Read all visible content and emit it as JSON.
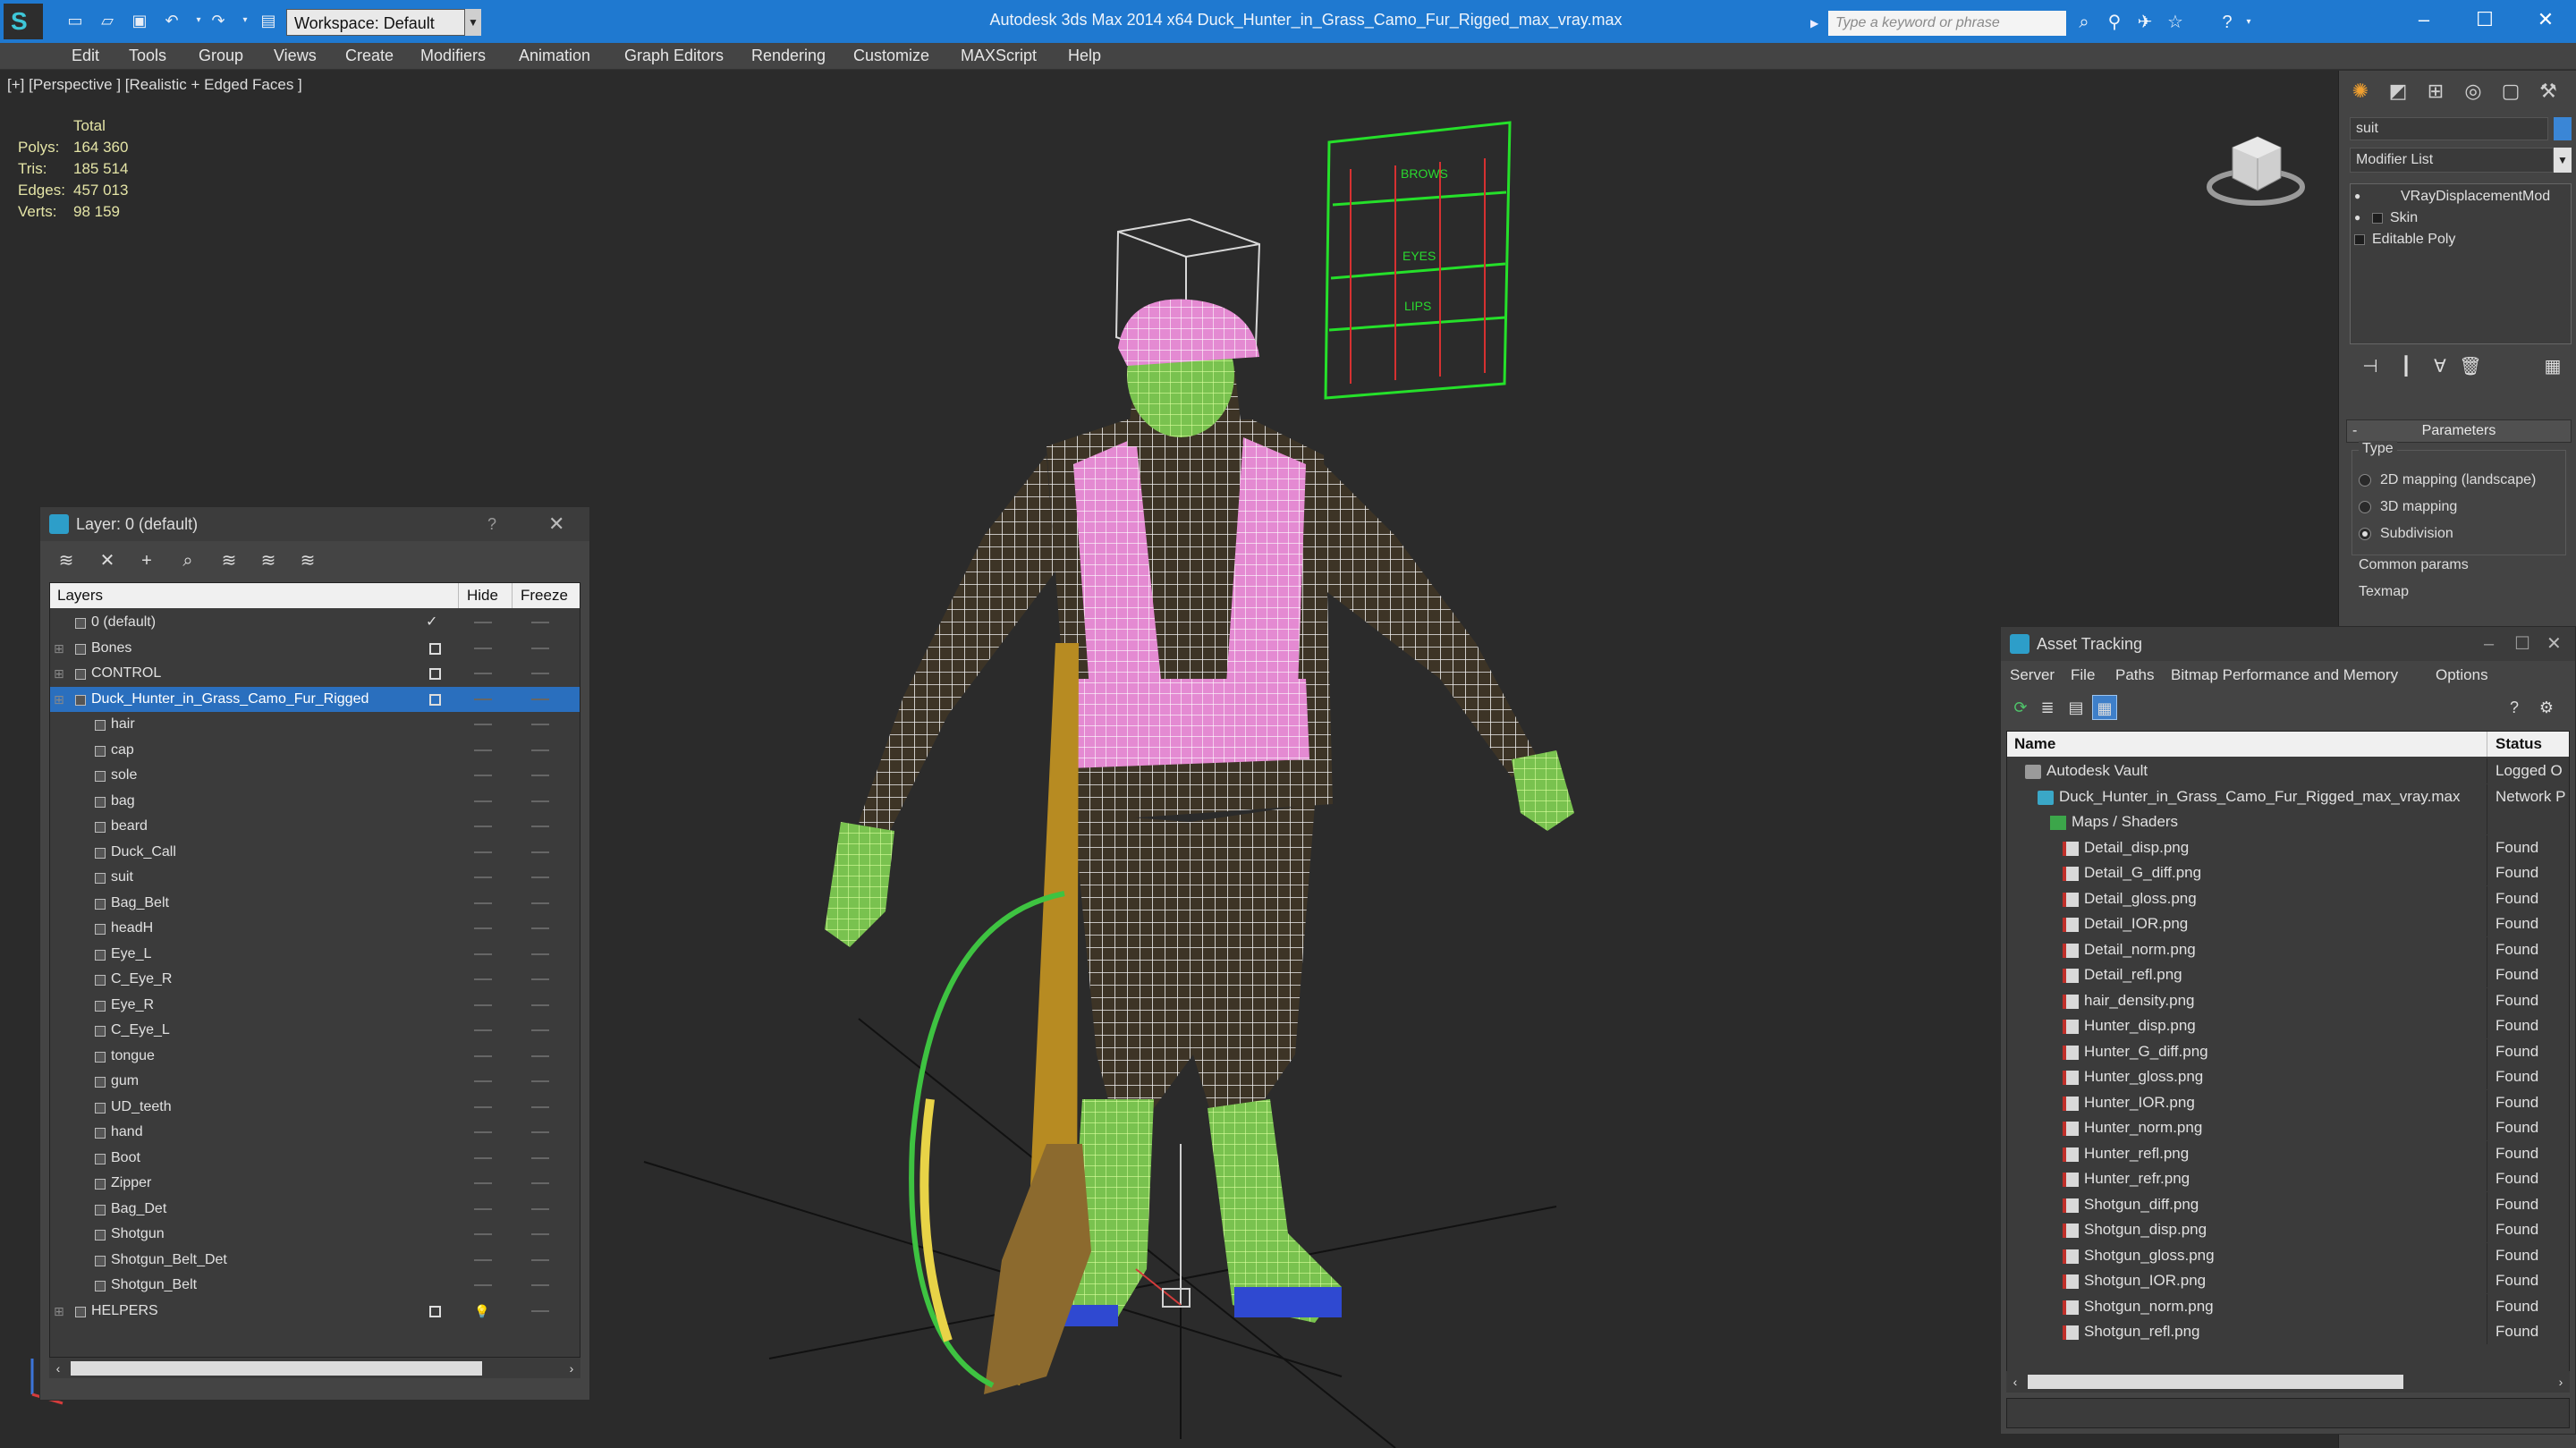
{
  "titlebar": {
    "workspace": "Workspace: Default",
    "title": "Autodesk 3ds Max  2014 x64      Duck_Hunter_in_Grass_Camo_Fur_Rigged_max_vray.max",
    "search_placeholder": "Type a keyword or phrase"
  },
  "menu": [
    "Edit",
    "Tools",
    "Group",
    "Views",
    "Create",
    "Modifiers",
    "Animation",
    "Graph Editors",
    "Rendering",
    "Customize",
    "MAXScript",
    "Help"
  ],
  "viewport": {
    "label": "[+] [Perspective ] [Realistic + Edged Faces ]",
    "stats_header": "Total",
    "stats": [
      {
        "key": "Polys:",
        "value": "164 360"
      },
      {
        "key": "Tris:",
        "value": "185 514"
      },
      {
        "key": "Edges:",
        "value": "457 013"
      },
      {
        "key": "Verts:",
        "value": "98 159"
      }
    ],
    "control_board_labels": [
      "BROWS",
      "EYES",
      "LIPS"
    ]
  },
  "command_panel": {
    "object_name": "suit",
    "object_color": "#3a86d6",
    "modifier_list": "Modifier List",
    "stack": [
      "VRayDisplacementMod",
      "Skin",
      "Editable Poly"
    ],
    "params_title": "Parameters",
    "type_label": "Type",
    "type_options": [
      {
        "label": "2D mapping (landscape)",
        "selected": false
      },
      {
        "label": "3D mapping",
        "selected": false
      },
      {
        "label": "Subdivision",
        "selected": true
      }
    ],
    "common_params": "Common params",
    "texmap": "Texmap"
  },
  "layer_panel": {
    "title": "Layer: 0 (default)",
    "help": "?",
    "col_layers": "Layers",
    "col_hide": "Hide",
    "col_freeze": "Freeze",
    "rows": [
      {
        "name": "0 (default)",
        "kind": "layer",
        "current": true
      },
      {
        "name": "Bones",
        "kind": "layer",
        "expand": true
      },
      {
        "name": "CONTROL",
        "kind": "layer",
        "expand": true
      },
      {
        "name": "Duck_Hunter_in_Grass_Camo_Fur_Rigged",
        "kind": "layer",
        "expand": true,
        "selected": true
      },
      {
        "name": "hair",
        "kind": "object"
      },
      {
        "name": "cap",
        "kind": "object"
      },
      {
        "name": "sole",
        "kind": "object"
      },
      {
        "name": "bag",
        "kind": "object"
      },
      {
        "name": "beard",
        "kind": "object"
      },
      {
        "name": "Duck_Call",
        "kind": "object"
      },
      {
        "name": "suit",
        "kind": "object"
      },
      {
        "name": "Bag_Belt",
        "kind": "object"
      },
      {
        "name": "headH",
        "kind": "object"
      },
      {
        "name": "Eye_L",
        "kind": "object"
      },
      {
        "name": "C_Eye_R",
        "kind": "object"
      },
      {
        "name": "Eye_R",
        "kind": "object"
      },
      {
        "name": "C_Eye_L",
        "kind": "object"
      },
      {
        "name": "tongue",
        "kind": "object"
      },
      {
        "name": "gum",
        "kind": "object"
      },
      {
        "name": "UD_teeth",
        "kind": "object"
      },
      {
        "name": "hand",
        "kind": "object"
      },
      {
        "name": "Boot",
        "kind": "object"
      },
      {
        "name": "Zipper",
        "kind": "object"
      },
      {
        "name": "Bag_Det",
        "kind": "object"
      },
      {
        "name": "Shotgun",
        "kind": "object"
      },
      {
        "name": "Shotgun_Belt_Det",
        "kind": "object"
      },
      {
        "name": "Shotgun_Belt",
        "kind": "object"
      },
      {
        "name": "HELPERS",
        "kind": "layer",
        "expand": true,
        "hidden": true
      }
    ]
  },
  "asset_panel": {
    "title": "Asset Tracking",
    "menu": [
      "Server",
      "File",
      "Paths",
      "Bitmap Performance and Memory",
      "Options"
    ],
    "col_name": "Name",
    "col_status": "Status",
    "rows": [
      {
        "name": "Autodesk Vault",
        "status": "Logged O",
        "level": 1,
        "icon": "vault"
      },
      {
        "name": "Duck_Hunter_in_Grass_Camo_Fur_Rigged_max_vray.max",
        "status": "Network P",
        "level": 2,
        "icon": "max"
      },
      {
        "name": "Maps / Shaders",
        "status": "",
        "level": 3,
        "icon": "folder"
      },
      {
        "name": "Detail_disp.png",
        "status": "Found",
        "level": 4,
        "icon": "png"
      },
      {
        "name": "Detail_G_diff.png",
        "status": "Found",
        "level": 4,
        "icon": "png"
      },
      {
        "name": "Detail_gloss.png",
        "status": "Found",
        "level": 4,
        "icon": "png"
      },
      {
        "name": "Detail_IOR.png",
        "status": "Found",
        "level": 4,
        "icon": "png"
      },
      {
        "name": "Detail_norm.png",
        "status": "Found",
        "level": 4,
        "icon": "png"
      },
      {
        "name": "Detail_refl.png",
        "status": "Found",
        "level": 4,
        "icon": "png"
      },
      {
        "name": "hair_density.png",
        "status": "Found",
        "level": 4,
        "icon": "png"
      },
      {
        "name": "Hunter_disp.png",
        "status": "Found",
        "level": 4,
        "icon": "png"
      },
      {
        "name": "Hunter_G_diff.png",
        "status": "Found",
        "level": 4,
        "icon": "png"
      },
      {
        "name": "Hunter_gloss.png",
        "status": "Found",
        "level": 4,
        "icon": "png"
      },
      {
        "name": "Hunter_IOR.png",
        "status": "Found",
        "level": 4,
        "icon": "png"
      },
      {
        "name": "Hunter_norm.png",
        "status": "Found",
        "level": 4,
        "icon": "png"
      },
      {
        "name": "Hunter_refl.png",
        "status": "Found",
        "level": 4,
        "icon": "png"
      },
      {
        "name": "Hunter_refr.png",
        "status": "Found",
        "level": 4,
        "icon": "png"
      },
      {
        "name": "Shotgun_diff.png",
        "status": "Found",
        "level": 4,
        "icon": "png"
      },
      {
        "name": "Shotgun_disp.png",
        "status": "Found",
        "level": 4,
        "icon": "png"
      },
      {
        "name": "Shotgun_gloss.png",
        "status": "Found",
        "level": 4,
        "icon": "png"
      },
      {
        "name": "Shotgun_IOR.png",
        "status": "Found",
        "level": 4,
        "icon": "png"
      },
      {
        "name": "Shotgun_norm.png",
        "status": "Found",
        "level": 4,
        "icon": "png"
      },
      {
        "name": "Shotgun_refl.png",
        "status": "Found",
        "level": 4,
        "icon": "png"
      }
    ]
  }
}
